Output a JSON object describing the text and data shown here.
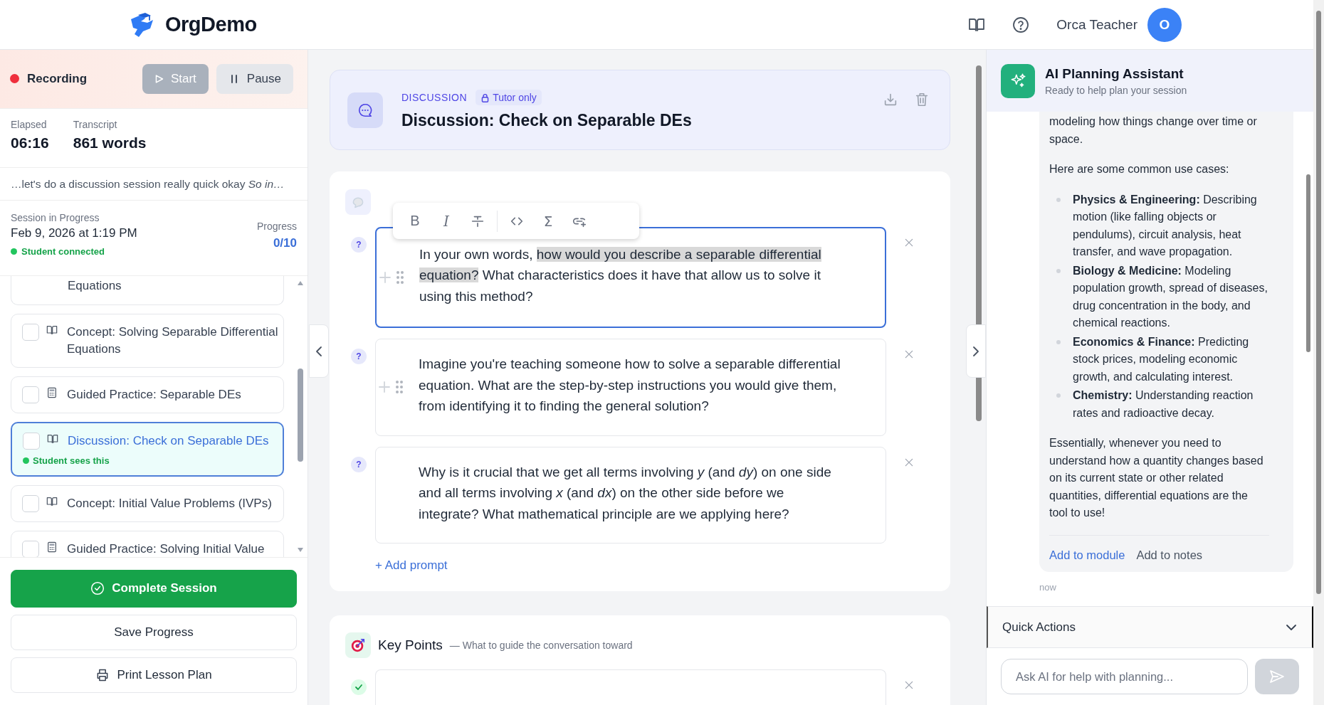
{
  "header": {
    "brand": "OrgDemo",
    "user_name": "Orca Teacher",
    "avatar_initial": "O"
  },
  "recording": {
    "label": "Recording",
    "active": true,
    "buttons": [
      {
        "label": "Start",
        "kind": "play",
        "disabled": true
      },
      {
        "label": "Pause",
        "kind": "pause",
        "disabled": false
      }
    ]
  },
  "stats": [
    {
      "label": "Elapsed",
      "value": "06:16"
    },
    {
      "label": "Transcript",
      "value": "861 words"
    }
  ],
  "transcript_snippet": "…let's do a discussion session really quick okay *So in…*",
  "session": {
    "status": "Session in Progress",
    "date": "Feb 9, 2026 at 1:19 PM",
    "student_status": "Student connected",
    "connected": true,
    "progress_label": "Progress",
    "progress": "0/10"
  },
  "lesson_items": [
    {
      "title": "Equations",
      "kind": "continued",
      "selected": false
    },
    {
      "title": "Concept: Solving Separable Differential Equations",
      "kind": "concept",
      "checked": false,
      "selected": false
    },
    {
      "title": "Guided Practice: Separable DEs",
      "kind": "practice",
      "checked": false,
      "selected": false
    },
    {
      "title": "Discussion: Check on Separable DEs",
      "kind": "concept",
      "checked": false,
      "selected": true,
      "note": "Student sees this"
    },
    {
      "title": "Concept: Initial Value Problems (IVPs)",
      "kind": "concept",
      "checked": false,
      "selected": false
    },
    {
      "title": "Guided Practice: Solving Initial Value",
      "kind": "practice",
      "checked": false,
      "selected": false
    }
  ],
  "actions": [
    {
      "label": "Complete Session",
      "kind": "primary"
    },
    {
      "label": "Save Progress",
      "kind": "secondary"
    },
    {
      "label": "Print Lesson Plan",
      "kind": "print"
    }
  ],
  "module": {
    "type": "DISCUSSION",
    "visibility": "Tutor only",
    "title": "Discussion: Check on Separable DEs"
  },
  "toolbar": [
    {
      "kind": "bold",
      "glyph": "B"
    },
    {
      "kind": "italic",
      "glyph": "I"
    },
    {
      "kind": "strike"
    },
    {
      "kind": "code"
    },
    {
      "kind": "math",
      "glyph": "Σ"
    },
    {
      "kind": "link"
    }
  ],
  "prompts": [
    {
      "badge": "?",
      "focused": true,
      "show_handles": true,
      "segments": [
        {
          "text": "In your own words, ",
          "highlighted": false
        },
        {
          "text": "how would you describe a separable differential equation?",
          "highlighted": true
        },
        {
          "text": " What characteristics does it have that allow us to solve it using this method?",
          "highlighted": false
        }
      ]
    },
    {
      "badge": "?",
      "focused": false,
      "show_handles": true,
      "segments": [
        {
          "text": "Imagine you're teaching someone how to solve a separable differential equation. What are the step-by-step instructions you would give them, from identifying it to finding the general solution?",
          "highlighted": false
        }
      ]
    },
    {
      "badge": "?",
      "focused": false,
      "show_handles": false,
      "segments": [
        {
          "text": "Why is it crucial that we get all terms involving *y* (and *dy*) on one side and all terms involving *x* (and *dx*) on the other side before we integrate? What mathematical principle are we applying here?",
          "highlighted": false
        }
      ]
    }
  ],
  "add_prompt": "+ Add prompt",
  "key_points": {
    "title": "Key Points",
    "subtitle": "— What to guide the conversation toward"
  },
  "assistant": {
    "title": "AI Planning Assistant",
    "subtitle": "Ready to help plan your session",
    "blocks": [
      {
        "kind": "paragraph",
        "text": "modeling how things change over time or space."
      },
      {
        "kind": "paragraph",
        "text": "Here are some common use cases:"
      },
      {
        "kind": "bullets",
        "items": [
          "**Physics & Engineering:** Describing motion (like falling objects or pendulums), circuit analysis, heat transfer, and wave propagation.",
          "**Biology & Medicine:** Modeling population growth, spread of diseases, drug concentration in the body, and chemical reactions.",
          "**Economics & Finance:** Predicting stock prices, modeling economic growth, and calculating interest.",
          "**Chemistry:** Understanding reaction rates and radioactive decay."
        ]
      },
      {
        "kind": "paragraph",
        "text": "Essentially, whenever you need to understand how a quantity changes based on its current state or other related quantities, differential equations are the tool to use!"
      }
    ],
    "message_actions": [
      {
        "label": "Add to module",
        "primary": true
      },
      {
        "label": "Add to notes",
        "primary": false
      }
    ],
    "time": "now",
    "quick_actions": {
      "label": "Quick Actions",
      "expanded": false
    },
    "input_placeholder": "Ask AI for help with planning..."
  }
}
